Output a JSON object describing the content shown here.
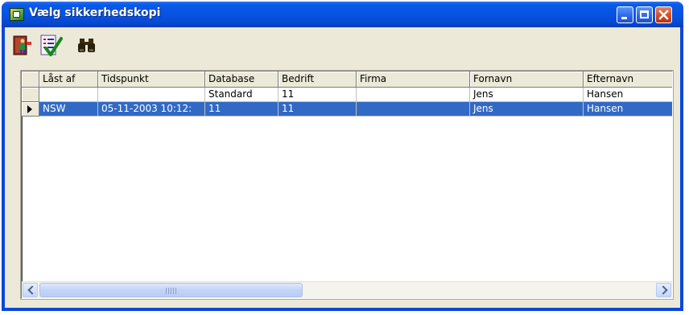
{
  "window": {
    "title": "Vælg sikkerhedskopi"
  },
  "toolbar": {
    "buttons": [
      {
        "icon": "exit-door-icon"
      },
      {
        "icon": "approve-checklist-icon"
      },
      {
        "icon": "binoculars-icon"
      }
    ]
  },
  "table": {
    "columns": [
      "Låst af",
      "Tidspunkt",
      "Database",
      "Bedrift",
      "Firma",
      "Fornavn",
      "Efternavn"
    ],
    "rows": [
      {
        "locked_by": "",
        "time": "",
        "database": "Standard",
        "farm": "11",
        "company": "",
        "first_name": "Jens",
        "last_name": "Hansen",
        "selected": false
      },
      {
        "locked_by": "NSW",
        "time": "05-11-2003 10:12:",
        "database": "11",
        "farm": "11",
        "company": "",
        "first_name": "Jens",
        "last_name": "Hansen",
        "selected": true
      }
    ]
  },
  "colors": {
    "titlebar": "#0a5ae8",
    "selection": "#316ac5",
    "client_bg": "#ece9d8"
  }
}
